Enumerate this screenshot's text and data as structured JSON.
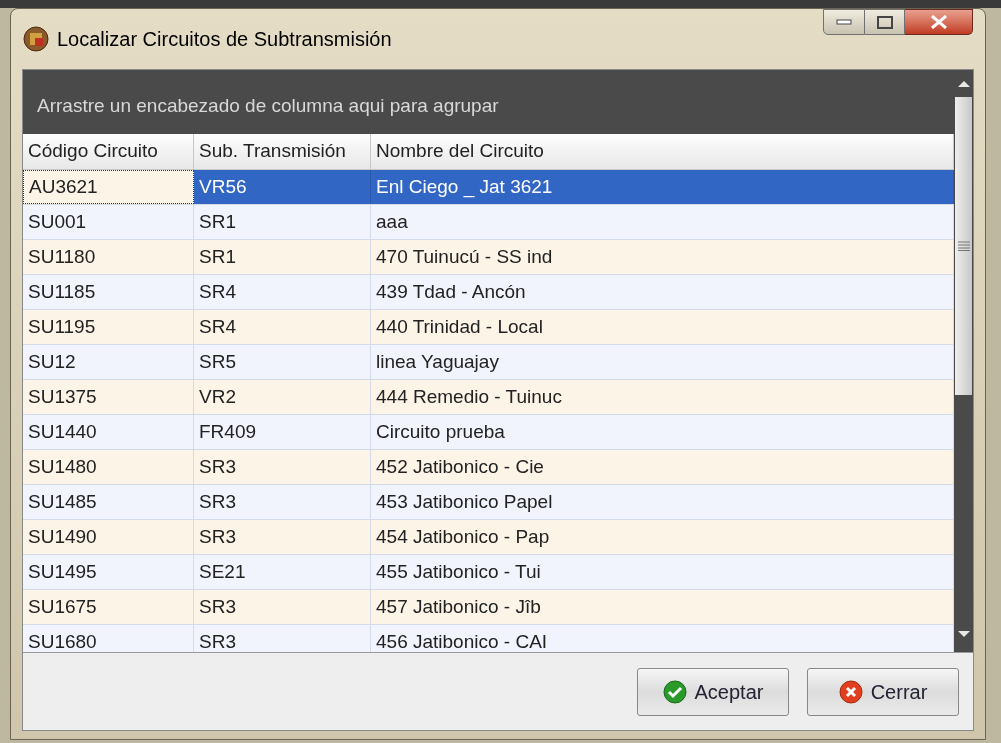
{
  "window": {
    "title": "Localizar Circuitos de Subtransmisión"
  },
  "group_panel": {
    "text": "Arrastre un encabezado de columna aqui para agrupar"
  },
  "table": {
    "columns": [
      "Código Circuito",
      "Sub. Transmisión",
      "Nombre del Circuito"
    ],
    "rows": [
      {
        "cells": [
          "AU3621",
          "VR56",
          "Enl Ciego _ Jat 3621"
        ],
        "selected": true
      },
      {
        "cells": [
          "SU001",
          "SR1",
          "aaa"
        ],
        "selected": false
      },
      {
        "cells": [
          "SU1180",
          "SR1",
          "470 Tuinucú - SS ind"
        ],
        "selected": false
      },
      {
        "cells": [
          "SU1185",
          "SR4",
          "439 Tdad - Ancón"
        ],
        "selected": false
      },
      {
        "cells": [
          "SU1195",
          "SR4",
          "440 Trinidad - Local"
        ],
        "selected": false
      },
      {
        "cells": [
          "SU12",
          "SR5",
          "linea Yaguajay"
        ],
        "selected": false
      },
      {
        "cells": [
          "SU1375",
          "VR2",
          "444 Remedio - Tuinuc"
        ],
        "selected": false
      },
      {
        "cells": [
          "SU1440",
          "FR409",
          "Circuito prueba"
        ],
        "selected": false
      },
      {
        "cells": [
          "SU1480",
          "SR3",
          "452 Jatibonico - Cie"
        ],
        "selected": false
      },
      {
        "cells": [
          "SU1485",
          "SR3",
          "453 Jatibonico Papel"
        ],
        "selected": false
      },
      {
        "cells": [
          "SU1490",
          "SR3",
          "454 Jatibonico - Pap"
        ],
        "selected": false
      },
      {
        "cells": [
          "SU1495",
          "SE21",
          "455 Jatibonico - Tui"
        ],
        "selected": false
      },
      {
        "cells": [
          "SU1675",
          "SR3",
          "457 Jatibonico - Jîb"
        ],
        "selected": false
      },
      {
        "cells": [
          "SU1680",
          "SR3",
          "456 Jatibonico - CAI"
        ],
        "selected": false
      }
    ]
  },
  "buttons": [
    {
      "kind": "ok",
      "label": "Aceptar"
    },
    {
      "kind": "cancel",
      "label": "Cerrar"
    }
  ]
}
